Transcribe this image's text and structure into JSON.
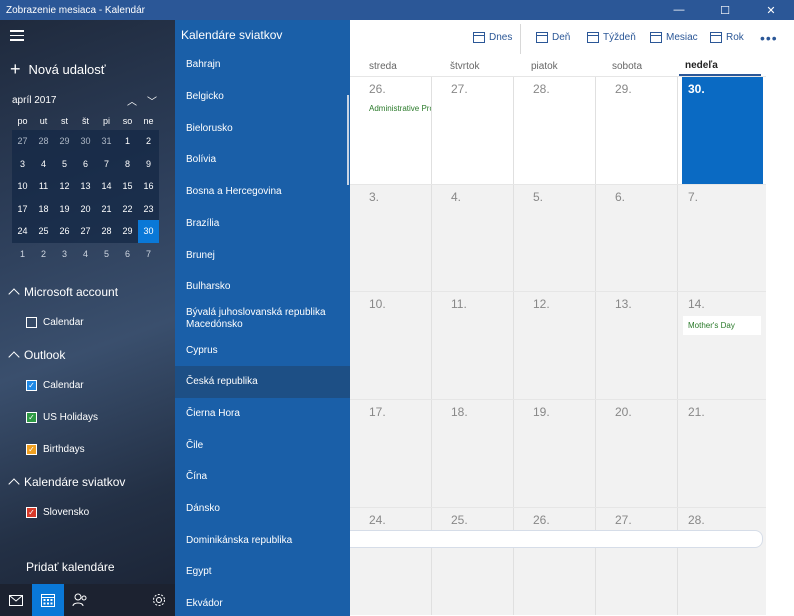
{
  "window": {
    "title": "Zobrazenie mesiaca - Kalendár",
    "minimize": "—",
    "maximize": "☐",
    "close": "✕"
  },
  "left": {
    "new_event": "Nová udalosť",
    "mini": {
      "month": "apríl 2017",
      "up": "︿",
      "down": "﹀",
      "dow": [
        "po",
        "ut",
        "st",
        "št",
        "pi",
        "so",
        "ne"
      ],
      "weeks": [
        [
          "27",
          "28",
          "29",
          "30",
          "31",
          "1",
          "2"
        ],
        [
          "3",
          "4",
          "5",
          "6",
          "7",
          "8",
          "9"
        ],
        [
          "10",
          "11",
          "12",
          "13",
          "14",
          "15",
          "16"
        ],
        [
          "17",
          "18",
          "19",
          "20",
          "21",
          "22",
          "23"
        ],
        [
          "24",
          "25",
          "26",
          "27",
          "28",
          "29",
          "30"
        ],
        [
          "1",
          "2",
          "3",
          "4",
          "5",
          "6",
          "7"
        ]
      ]
    },
    "sections": [
      {
        "title": "Microsoft account",
        "items": [
          {
            "label": "Calendar",
            "checked": false,
            "color": "#ffffff"
          }
        ]
      },
      {
        "title": "Outlook",
        "items": [
          {
            "label": "Calendar",
            "checked": true,
            "color": "#1e88e5"
          },
          {
            "label": "US Holidays",
            "checked": true,
            "color": "#2e9a44"
          },
          {
            "label": "Birthdays",
            "checked": true,
            "color": "#f0a020"
          }
        ]
      },
      {
        "title": "Kalendáre sviatkov",
        "items": [
          {
            "label": "Slovensko",
            "checked": true,
            "color": "#d63a2a"
          }
        ]
      }
    ],
    "add_calendars": "Pridať kalendáre"
  },
  "flyout": {
    "title": "Kalendáre sviatkov",
    "items": [
      "Bahrajn",
      "Belgicko",
      "Bielorusko",
      "Bolívia",
      "Bosna a Hercegovina",
      "Brazília",
      "Brunej",
      "Bulharsko",
      "Bývalá juhoslovanská republika Macedónsko",
      "Cyprus",
      "Česká republika",
      "Čierna Hora",
      "Čile",
      "Čína",
      "Dánsko",
      "Dominikánska republika",
      "Egypt",
      "Ekvádor"
    ]
  },
  "toolbar": {
    "today": "Dnes",
    "day": "Deň",
    "week": "Týždeň",
    "month": "Mesiac",
    "year": "Rok",
    "more": "•••"
  },
  "month": {
    "dow": [
      "streda",
      "štvrtok",
      "piatok",
      "sobota",
      "nedeľa"
    ],
    "weeks": [
      {
        "days": [
          "26.",
          "27.",
          "28.",
          "29.",
          "30."
        ]
      },
      {
        "days": [
          "3.",
          "4.",
          "5.",
          "6.",
          "7."
        ]
      },
      {
        "days": [
          "10.",
          "11.",
          "12.",
          "13.",
          "14."
        ]
      },
      {
        "days": [
          "17.",
          "18.",
          "19.",
          "20.",
          "21."
        ]
      },
      {
        "days": [
          "24.",
          "25.",
          "26.",
          "27.",
          "28."
        ]
      }
    ],
    "events": {
      "admin": "Administrative Pro",
      "mothers": "Mother's Day"
    }
  },
  "colors": {
    "accent": "#0a78d7",
    "flyout": "#1a5fa8",
    "titlebar": "#2b5797"
  },
  "icons": {
    "mail": "mail-icon",
    "calendar": "calendar-icon",
    "people": "people-icon",
    "settings": "gear-icon"
  }
}
